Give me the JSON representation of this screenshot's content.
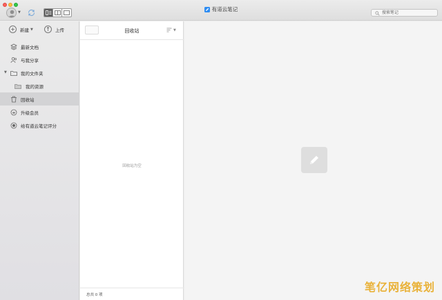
{
  "window": {
    "app_title": "有道云笔记",
    "search_placeholder": "搜索笔记"
  },
  "sidebar": {
    "new_label": "新建",
    "upload_label": "上传",
    "items": [
      {
        "label": "最新文档",
        "icon": "layers-icon"
      },
      {
        "label": "与我分享",
        "icon": "people-icon"
      },
      {
        "label": "我的文件夹",
        "icon": "folder-icon"
      },
      {
        "label": "我的资源",
        "icon": "folder-icon"
      },
      {
        "label": "回收站",
        "icon": "trash-icon"
      },
      {
        "label": "升级会员",
        "icon": "member-icon"
      },
      {
        "label": "给有道云笔记评分",
        "icon": "rating-icon"
      }
    ]
  },
  "notelist": {
    "title": "回收站",
    "empty_text": "回收站为空",
    "count_text": "总共 0 项"
  },
  "watermark": "笔亿网络策划",
  "colors": {
    "accent": "#2f8df2",
    "selected_row": "#d3d3d5",
    "watermark": "#e9b23a"
  }
}
